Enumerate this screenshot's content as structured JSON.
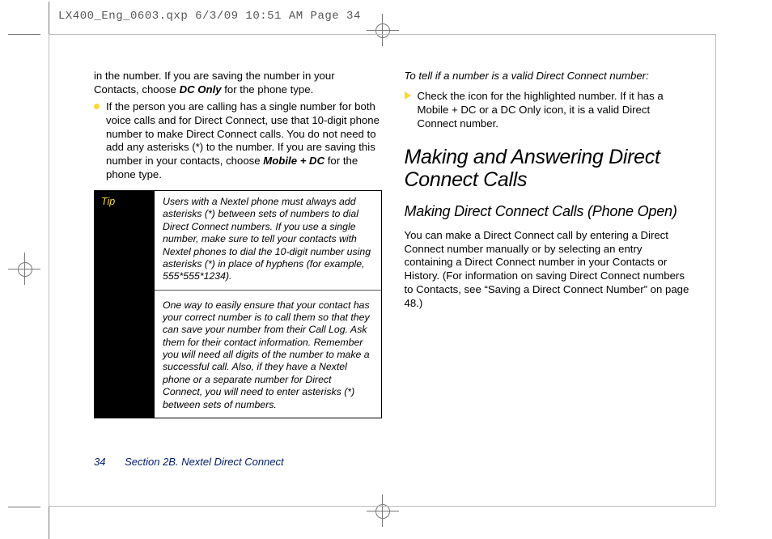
{
  "slug": "LX400_Eng_0603.qxp  6/3/09  10:51 AM  Page 34",
  "left_col": {
    "intro_part1": "in the number. If you are saving the number in your Contacts, choose ",
    "intro_bold": "DC Only",
    "intro_part2": " for the phone type.",
    "bullet_part1": "If the person you are calling has a single number for both voice calls and for Direct Connect, use that 10-digit phone number to make Direct Connect calls. You do not need to add any asterisks (*) to the number. If you are saving this number in your contacts, choose ",
    "bullet_bold": "Mobile + DC",
    "bullet_part2": " for the phone type.",
    "tip_label": "Tip",
    "tip1": "Users with a Nextel phone must always add asterisks (*) between sets of numbers to dial Direct Connect numbers. If you use a single number, make sure to tell your contacts with Nextel phones to dial the 10-digit number using asterisks (*) in place of hyphens (for example, 555*555*1234).",
    "tip2": "One way to easily ensure that your contact has your correct number is to call them so that they can save your number from their Call Log. Ask them for their contact information. Remember you will need all digits of the number to make a successful call. Also, if they have a Nextel phone or a separate number for Direct Connect, you will need to enter asterisks (*) between sets of numbers."
  },
  "right_col": {
    "lead": "To tell if a number is a valid Direct Connect number:",
    "check_item": "Check the icon for the highlighted number. If it has a Mobile + DC or a DC Only icon, it is a valid Direct Connect number.",
    "h1": "Making and Answering Direct Connect Calls",
    "h2": "Making Direct Connect Calls (Phone Open)",
    "body": "You can make a Direct Connect call by entering a Direct Connect number manually or by selecting an entry containing a Direct Connect number in your Contacts or History. (For information on saving Direct Connect numbers to Contacts, see “Saving a Direct Connect Number” on page  48.)"
  },
  "footer": {
    "page": "34",
    "section": "Section 2B. Nextel Direct Connect"
  }
}
